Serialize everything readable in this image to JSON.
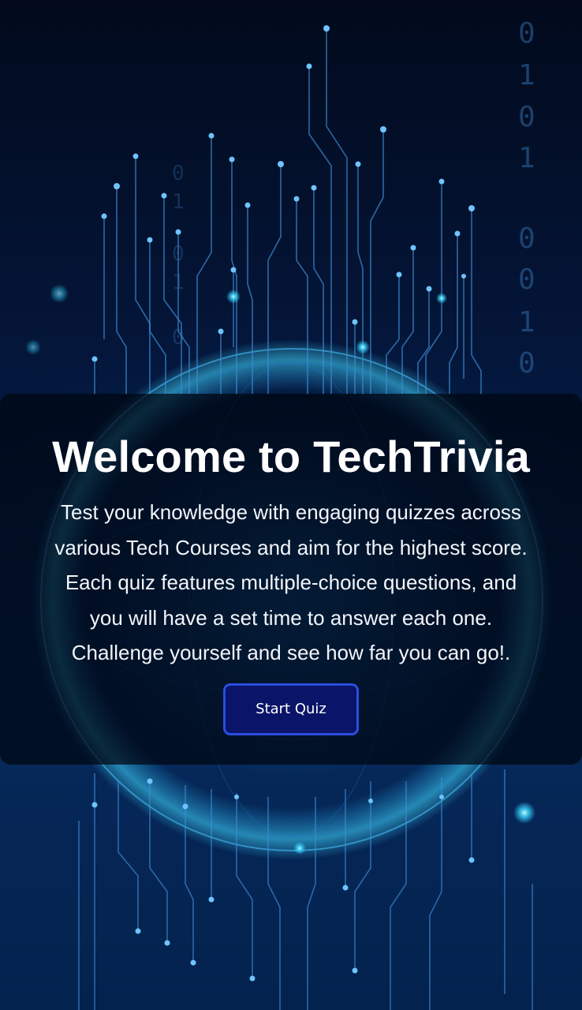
{
  "welcome": {
    "title": "Welcome to TechTrivia",
    "description_lines": [
      "Test your knowledge with engaging quizzes across",
      "various Tech Courses and aim for the highest score.",
      "Each quiz features multiple-choice questions, and",
      "you will have a set time to answer each one.",
      "Challenge yourself and see how far you can go!."
    ],
    "start_button_label": "Start Quiz"
  },
  "background": {
    "binary_digits_right": [
      "0",
      "1",
      "0",
      "1",
      "0",
      "0",
      "1",
      "0"
    ],
    "binary_digits_left": [
      "0",
      "1",
      "0",
      "1",
      "0"
    ],
    "accent_colors": {
      "circuit_line": "#3d8fd8",
      "glow": "#38d6ff",
      "button_fill": "#0a1468",
      "button_border": "#2a4ee0"
    }
  }
}
